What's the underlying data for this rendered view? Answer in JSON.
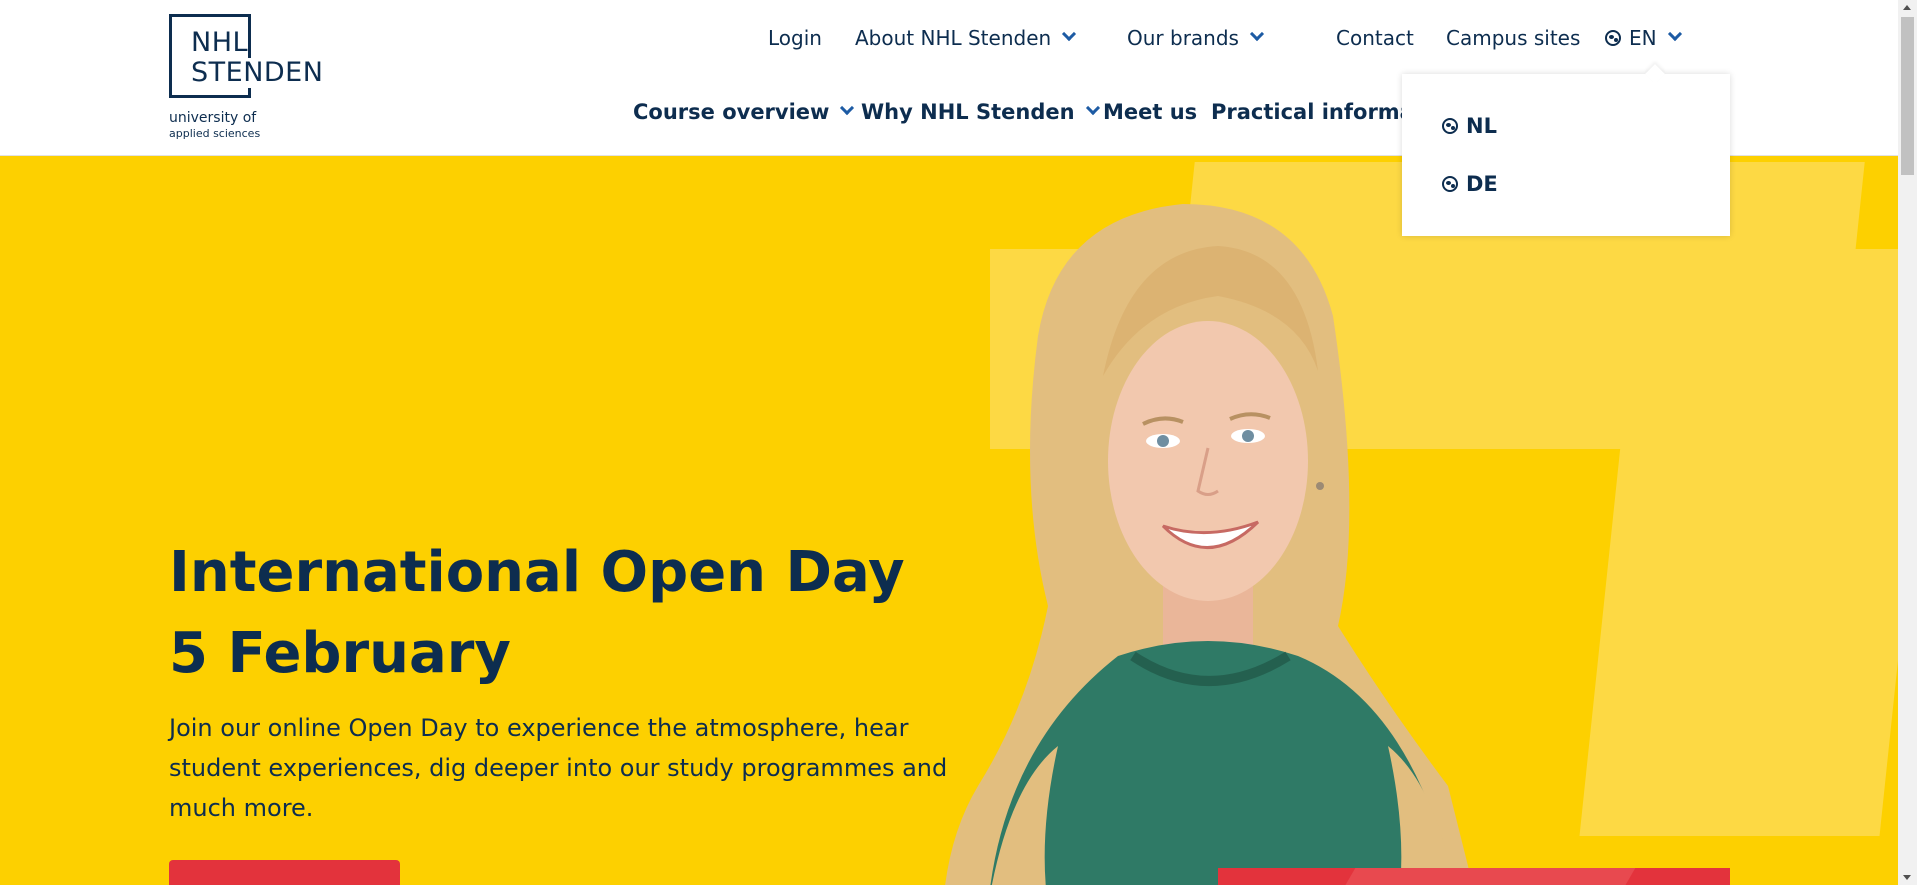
{
  "brand": {
    "logo_line1": "NHL",
    "logo_line2": "STENDEN",
    "logo_sub1": "university of",
    "logo_sub2": "applied sciences"
  },
  "top_nav": {
    "login": "Login",
    "about": "About NHL Stenden",
    "brands": "Our brands",
    "contact": "Contact",
    "campus": "Campus sites",
    "language": "EN"
  },
  "main_nav": {
    "course": "Course overview",
    "why": "Why NHL Stenden",
    "meet": "Meet us",
    "practical": "Practical informati"
  },
  "language_dropdown": {
    "options": [
      "NL",
      "DE"
    ]
  },
  "hero": {
    "title_line1": "International Open Day",
    "title_line2": "5 February",
    "text": "Join our online Open Day to experience the atmosphere, hear student experiences, dig deeper into our study programmes and much more."
  },
  "colors": {
    "navy": "#0d2d4f",
    "accent_blue": "#1d5ba4",
    "hero_yellow": "#fdd000",
    "cta_red": "#e3333c"
  }
}
